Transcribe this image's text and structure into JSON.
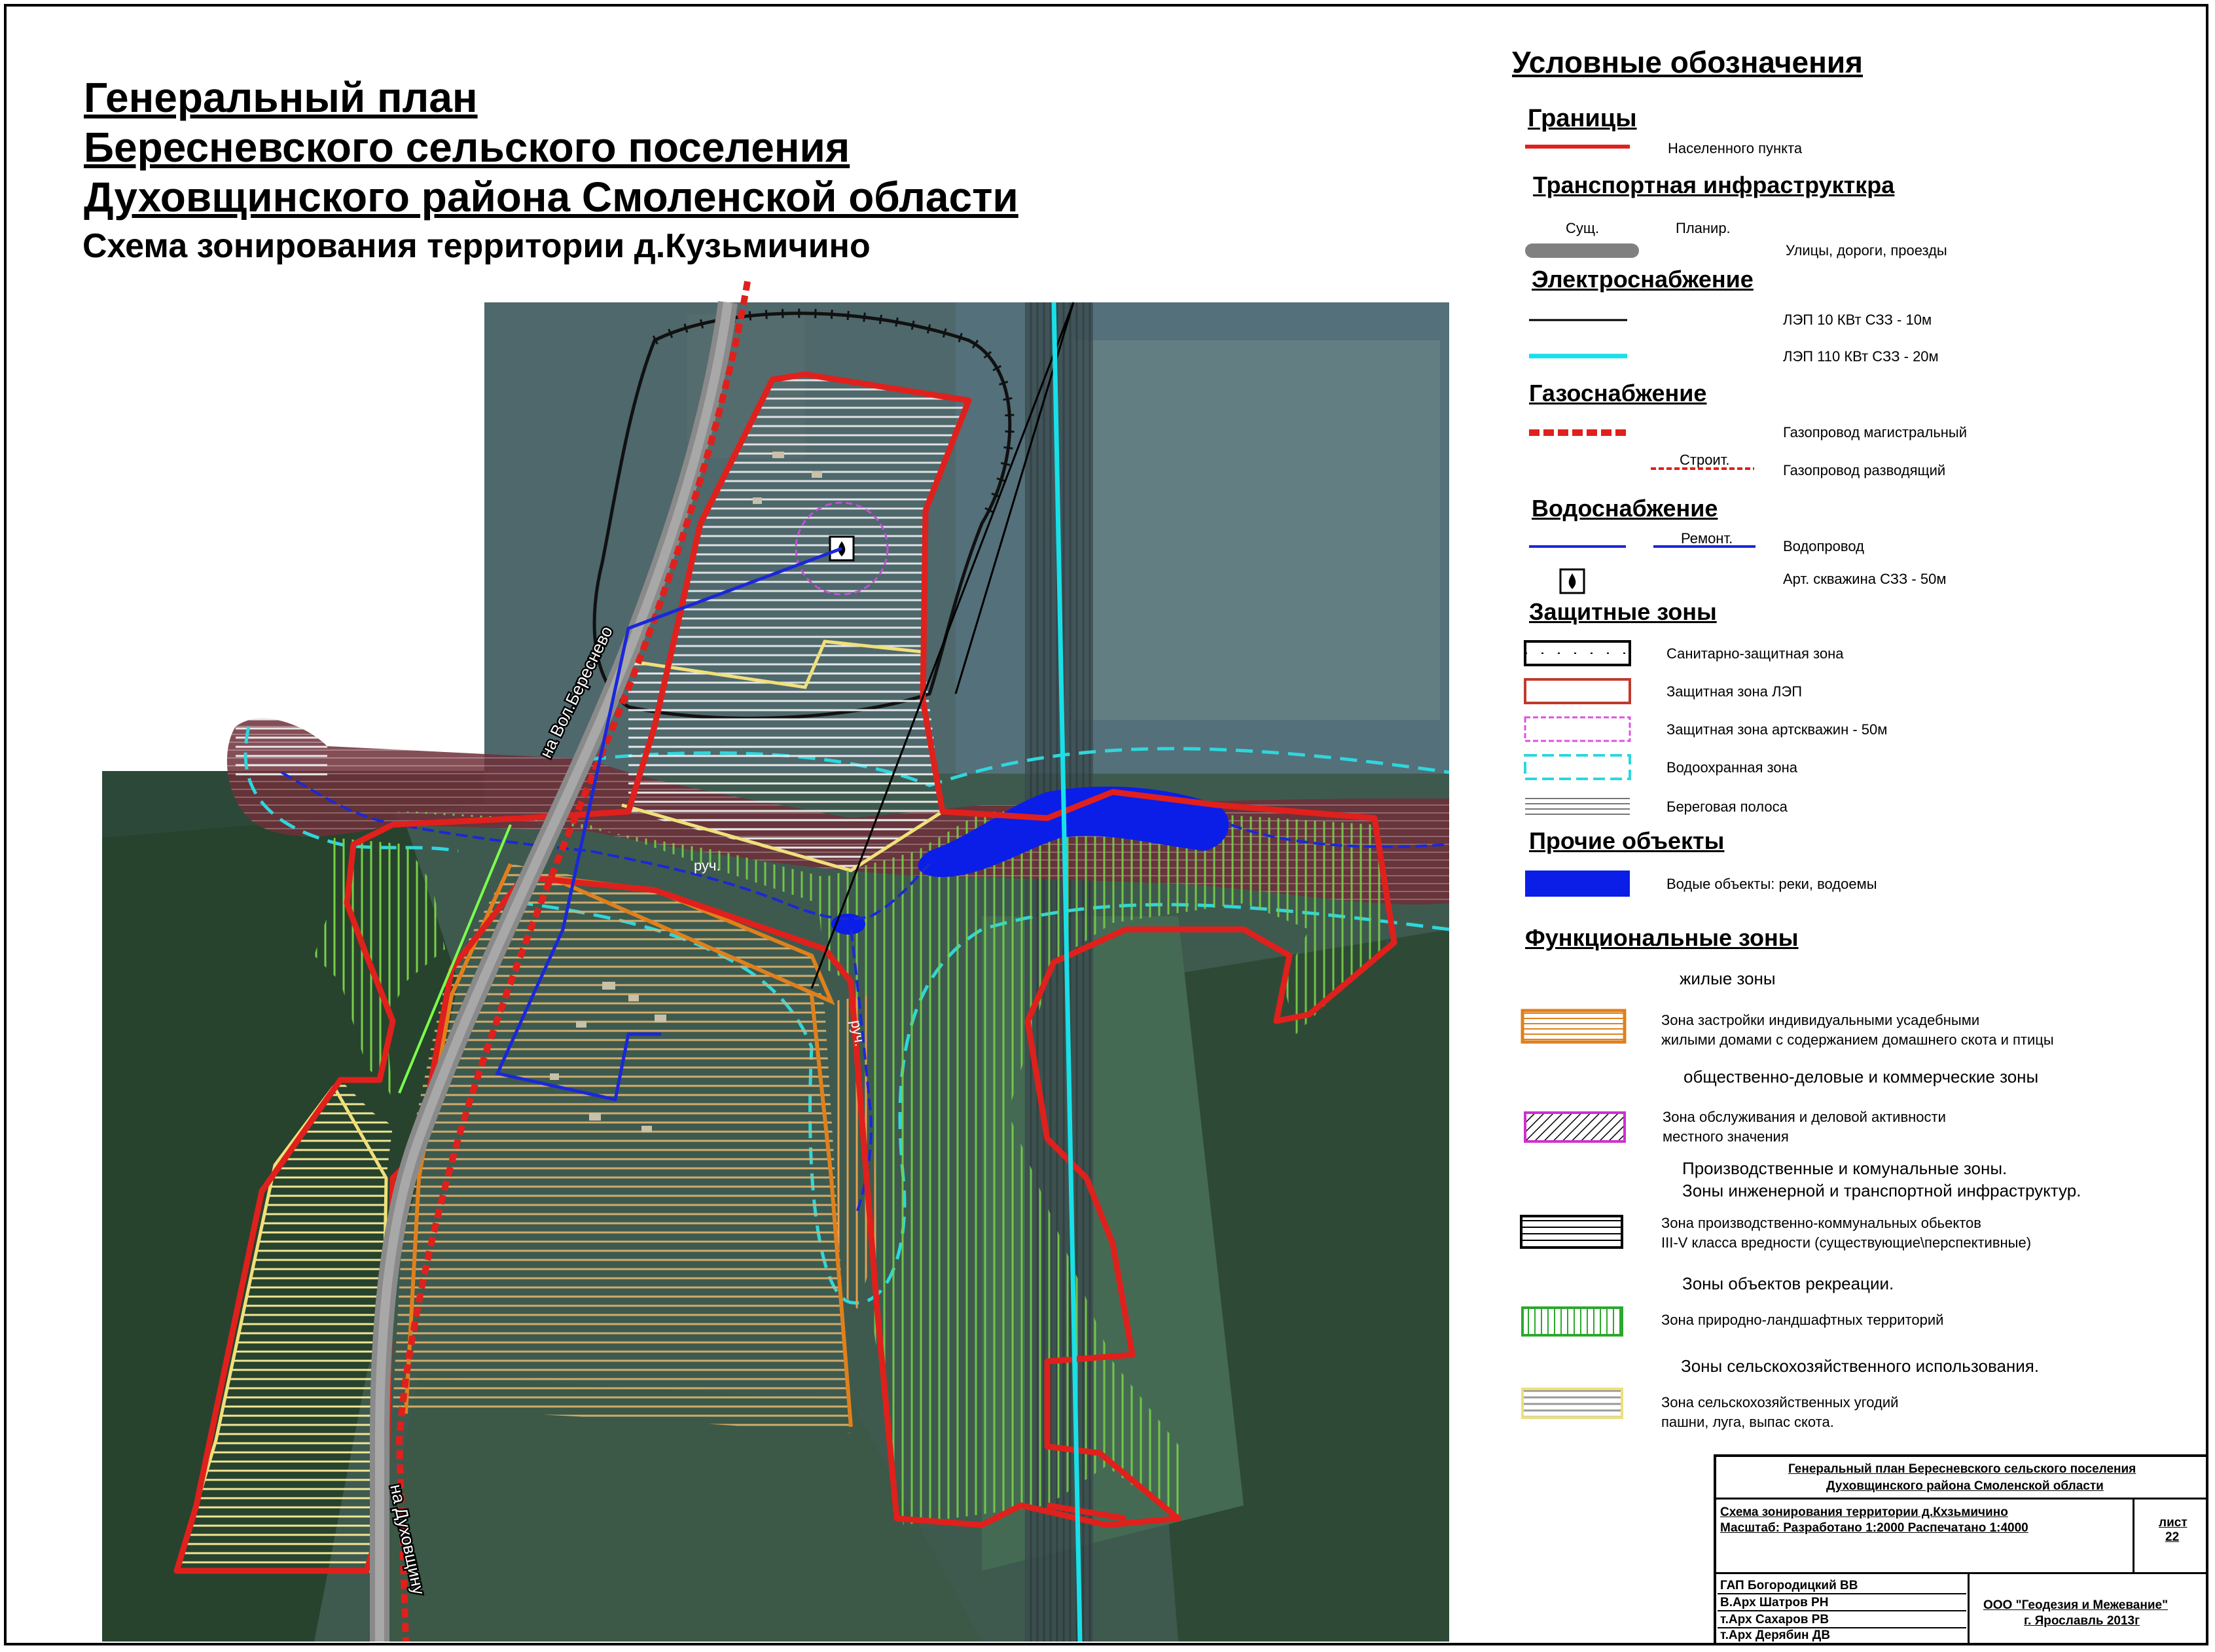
{
  "title": {
    "line1": "Генеральный план",
    "line2": "Бересневского сельского поселения",
    "line3": "Духовщинского района Смоленской области",
    "subtitle": "Схема зонирования территории  д.Кузьмичино"
  },
  "map": {
    "road_label_north": "на Вол.Береснево",
    "road_label_south": "на Духовщину",
    "stream_label_1": "руч.",
    "stream_label_2": "руч."
  },
  "legend": {
    "heading": "Условные обозначения",
    "sections": {
      "borders": "Границы",
      "transport": "Транспортная инфраструкткра",
      "power": "Электроснабжение",
      "gas": "Газоснабжение",
      "water": "Водоснабжение",
      "protect": "Защитные зоны",
      "other": "Прочие объекты",
      "functional": "Функциональные зоны"
    },
    "items": {
      "settlement": "Населенного пункта",
      "exist": "Сущ.",
      "plan": "Планир.",
      "roads": "Улицы, дороги, проезды",
      "lep10": "ЛЭП 10 КВт  СЗЗ - 10м",
      "lep110": "ЛЭП 110 КВт  СЗЗ - 20м",
      "gas_main": "Газопровод магистральный",
      "gas_build": "Строит.",
      "gas_dist": "Газопровод разводящий",
      "water_repair": "Ремонт.",
      "water_pipe": "Водопровод",
      "well": "Арт. скважина     СЗЗ - 50м",
      "sanitary": "Санитарно-защитная зона",
      "lep_zone": "Защитная зона ЛЭП",
      "well_zone": "Защитная зона артскважин - 50м",
      "water_protect": "Водоохранная зона",
      "shore": "Береговая полоса",
      "water_obj": "Водые объекты: реки, водоемы",
      "residential_head": "жилые зоны",
      "residential_1": "Зона застройки индивидуальными усадебными",
      "residential_2": "жилыми домами с содержанием домашнего скота и птицы",
      "business_head": "общественно-деловые и коммерческие зоны",
      "business_1": "Зона обслуживания и деловой активности",
      "business_2": "местного значения",
      "industry_head_1": "Производственные и комунальные зоны.",
      "industry_head_2": "Зоны инженерной и транспортной инфраструктур.",
      "industry_1": "Зона производственно-коммунальных обьектов",
      "industry_2": "III-V класса вредности  (существующие\\перспективные)",
      "recreation_head": "Зоны объектов рекреации.",
      "recreation": "Зона природно-ландшафтных территорий",
      "agri_head": "Зоны сельскохозяйственного использования.",
      "agri_1": "Зона сельскохозяйственных угодий",
      "agri_2": "пашни, луга, выпас скота."
    }
  },
  "stamp": {
    "line1": "Генеральный план Бересневского сельского поселения",
    "line2": "Духовщинского района Смоленской области",
    "scheme": "Схема зонирования территории д.Кхзьмичино",
    "scale": "Масштаб: Разработано 1:2000 Распечатано 1:4000",
    "sheet_label": "лист",
    "sheet_num": "22",
    "gap": "ГАП     Богородицкий ВВ",
    "varh": "В.Арх  Шатров РН",
    "tarh1": "т.Арх   Сахаров РВ",
    "tarh2": "т.Арх   Дерябин ДВ",
    "org": "ООО \"Геодезия и Межевание\"",
    "city": "г. Ярославль 2013г"
  },
  "colors": {
    "border_red": "#e0201c",
    "orange_zone": "#e0801c",
    "yellow_zone": "#ece07a",
    "green_zone": "#4cc43c",
    "water_blue": "#0a1ee8",
    "cyan_line": "#18e0e8",
    "pipe_blue": "#1a28d8"
  }
}
